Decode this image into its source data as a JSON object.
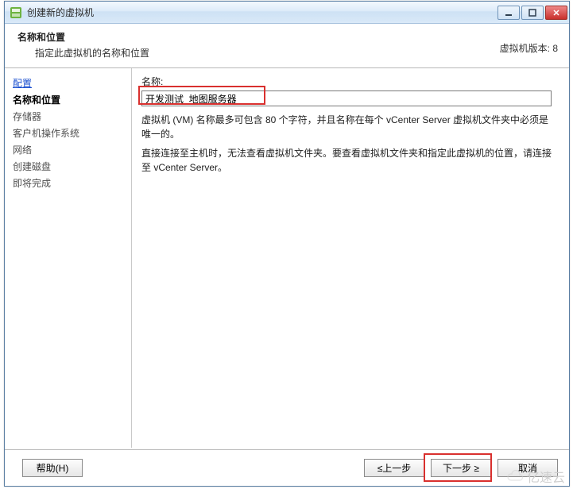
{
  "window": {
    "title": "创建新的虚拟机"
  },
  "header": {
    "title": "名称和位置",
    "subtitle": "指定此虚拟机的名称和位置",
    "version_label": "虚拟机版本: 8"
  },
  "sidebar": {
    "items": [
      {
        "label": "配置",
        "link": true
      },
      {
        "label": "名称和位置",
        "active": true
      },
      {
        "label": "存储器"
      },
      {
        "label": "客户机操作系统"
      },
      {
        "label": "网络"
      },
      {
        "label": "创建磁盘"
      },
      {
        "label": "即将完成"
      }
    ]
  },
  "form": {
    "name_label": "名称:",
    "name_value": "开发测试_地图服务器",
    "help1": "虚拟机 (VM) 名称最多可包含 80 个字符，并且名称在每个 vCenter Server 虚拟机文件夹中必须是唯一的。",
    "help2": "直接连接至主机时，无法查看虚拟机文件夹。要查看虚拟机文件夹和指定此虚拟机的位置，请连接至 vCenter Server。"
  },
  "footer": {
    "help": "帮助(H)",
    "back": "≤上一步",
    "next": "下一步 ≥",
    "cancel": "取消"
  },
  "watermark": {
    "text": "亿速云"
  },
  "colors": {
    "highlight": "#d9302e"
  }
}
